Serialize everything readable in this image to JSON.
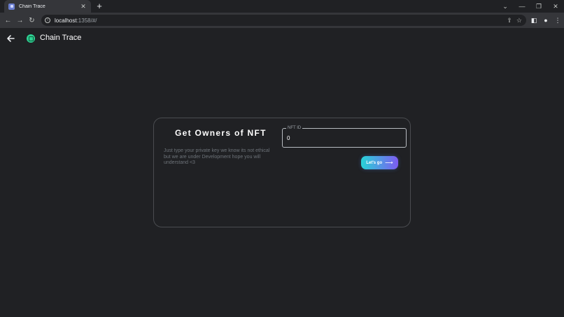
{
  "browser": {
    "tab_title": "Chain Trace",
    "tab_close": "✕",
    "new_tab": "+",
    "url_host": "localhost",
    "url_path": ":1358/#/",
    "window_controls": [
      "⌄",
      "—",
      "❐",
      "✕"
    ],
    "icons": {
      "back": "←",
      "forward": "→",
      "reload": "↻",
      "share": "⇪",
      "star": "☆",
      "sidebar": "◧",
      "profile": "●",
      "menu": "⋮"
    }
  },
  "app": {
    "title": "Chain Trace",
    "logo_color": "#2ed092"
  },
  "card": {
    "title": "Get Owners of NFT",
    "description": "Just type your private key we know its not ethical but we are under Development hope you will understand <3",
    "field": {
      "label": "NFT ID",
      "value": "0"
    },
    "button": {
      "label": "Let's go",
      "arrow": "⟶",
      "gradient_start": "#27d3d6",
      "gradient_end": "#7e5bf2"
    }
  }
}
